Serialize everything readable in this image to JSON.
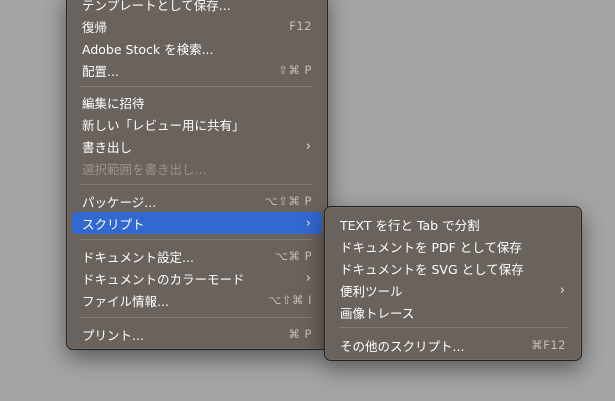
{
  "main_menu": {
    "items": [
      {
        "label": "テンプレートとして保存...",
        "shortcut": ""
      },
      {
        "label": "復帰",
        "shortcut": "F12"
      },
      {
        "label": "Adobe Stock を検索...",
        "shortcut": ""
      },
      {
        "label": "配置...",
        "shortcut": "⇧⌘ P"
      },
      {
        "label": "編集に招待",
        "shortcut": ""
      },
      {
        "label": "新しい「レビュー用に共有」",
        "shortcut": ""
      },
      {
        "label": "書き出し",
        "shortcut": "›"
      },
      {
        "label": "選択範囲を書き出し...",
        "shortcut": ""
      },
      {
        "label": "パッケージ...",
        "shortcut": "⌥⇧⌘ P"
      },
      {
        "label": "スクリプト",
        "shortcut": "›"
      },
      {
        "label": "ドキュメント設定...",
        "shortcut": "⌥⌘ P"
      },
      {
        "label": "ドキュメントのカラーモード",
        "shortcut": "›"
      },
      {
        "label": "ファイル情報...",
        "shortcut": "⌥⇧⌘ I"
      },
      {
        "label": "プリント...",
        "shortcut": "⌘ P"
      }
    ]
  },
  "sub_menu": {
    "items": [
      {
        "label": "TEXT を行と Tab で分割",
        "shortcut": ""
      },
      {
        "label": "ドキュメントを PDF として保存",
        "shortcut": ""
      },
      {
        "label": "ドキュメントを SVG として保存",
        "shortcut": ""
      },
      {
        "label": "便利ツール",
        "shortcut": "›"
      },
      {
        "label": "画像トレース",
        "shortcut": ""
      },
      {
        "label": "その他のスクリプト...",
        "shortcut": "⌘F12"
      }
    ]
  },
  "colors": {
    "background": "#a4a4a4",
    "menu": "#6a625c",
    "highlight": "#3168d1"
  }
}
